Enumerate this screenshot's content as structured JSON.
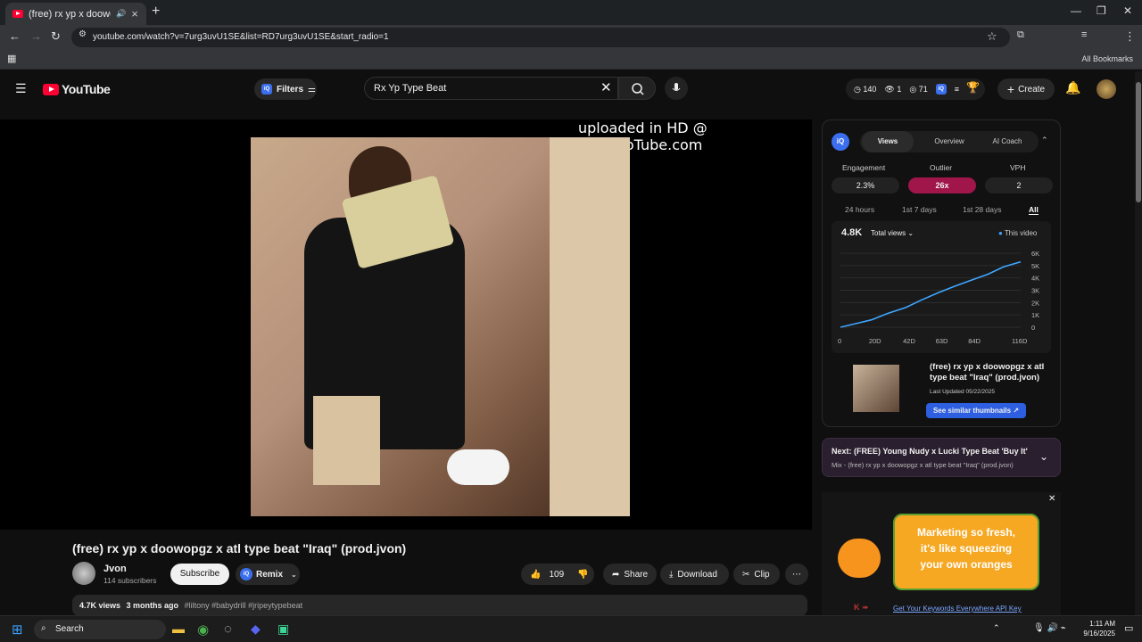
{
  "browser": {
    "tab_title": "(free) rx yp x doowopgz x at",
    "url": "youtube.com/watch?v=7urg3uvU1SE&list=RD7urg3uvU1SE&start_radio=1",
    "all_bookmarks": "All Bookmarks"
  },
  "header": {
    "logo_text": "YouTube",
    "filters_label": "Filters",
    "search_query": "Rx Yp Type Beat",
    "stats": {
      "time": "140",
      "eye_a": "1",
      "eye_b": "71"
    },
    "create_label": "Create"
  },
  "player": {
    "overlay_text": "uploaded in HD @ TunesToTube.com"
  },
  "video": {
    "title": "(free) rx yp x doowopgz x atl type beat \"Iraq\" (prod.jvon)",
    "channel_name": "Jvon",
    "subscribers": "114 subscribers",
    "subscribe_label": "Subscribe",
    "remix_label": "Remix",
    "likes": "109",
    "share_label": "Share",
    "download_label": "Download",
    "clip_label": "Clip",
    "views": "4.7K views",
    "age": "3 months ago",
    "hashtags": "#liltony #babydrill #jripeytypebeat"
  },
  "vidiq": {
    "tabs": [
      "Views",
      "Overview",
      "AI Coach"
    ],
    "metrics": [
      {
        "label": "Engagement",
        "value": "2.3%"
      },
      {
        "label": "Outlier",
        "value": "26x"
      },
      {
        "label": "VPH",
        "value": "2"
      }
    ],
    "ranges": [
      "24 hours",
      "1st 7 days",
      "1st 28 days",
      "All"
    ],
    "total": "4.8K",
    "total_label": "Total views",
    "legend": "This video",
    "rec_title": "(free) rx yp x doowopgz x atl type beat \"Iraq\" (prod.jvon)",
    "rec_date": "Last Updated 05/22/2025",
    "similar_label": "See similar thumbnails ↗"
  },
  "chart_data": {
    "type": "line",
    "x": [
      0,
      10,
      20,
      30,
      42,
      52,
      63,
      73,
      84,
      95,
      105,
      116
    ],
    "series": [
      {
        "values": [
          0,
          300,
          600,
          1100,
          1600,
          2200,
          2800,
          3300,
          3800,
          4300,
          4900,
          5300
        ]
      }
    ],
    "x_ticks": [
      "0",
      "20D",
      "42D",
      "63D",
      "84D",
      "116D"
    ],
    "y_ticks": [
      "0",
      "1K",
      "2K",
      "3K",
      "4K",
      "5K",
      "6K"
    ],
    "ylim": [
      0,
      6000
    ],
    "xlim": [
      0,
      116
    ],
    "line_color": "#3ea6ff"
  },
  "next": {
    "title": "Next: (FREE) Young Nudy x Lucki Type Beat 'Buy It'",
    "subtitle": "Mix - (free) rx yp x doowopgz x atl type beat \"Iraq\" (prod.jvon)"
  },
  "ad": {
    "text": "Marketing so fresh, it's like squeezing your own oranges",
    "link": "Get Your Keywords Everywhere API Key"
  },
  "taskbar": {
    "search_label": "Search",
    "time": "1:11 AM",
    "date": "9/16/2025"
  }
}
